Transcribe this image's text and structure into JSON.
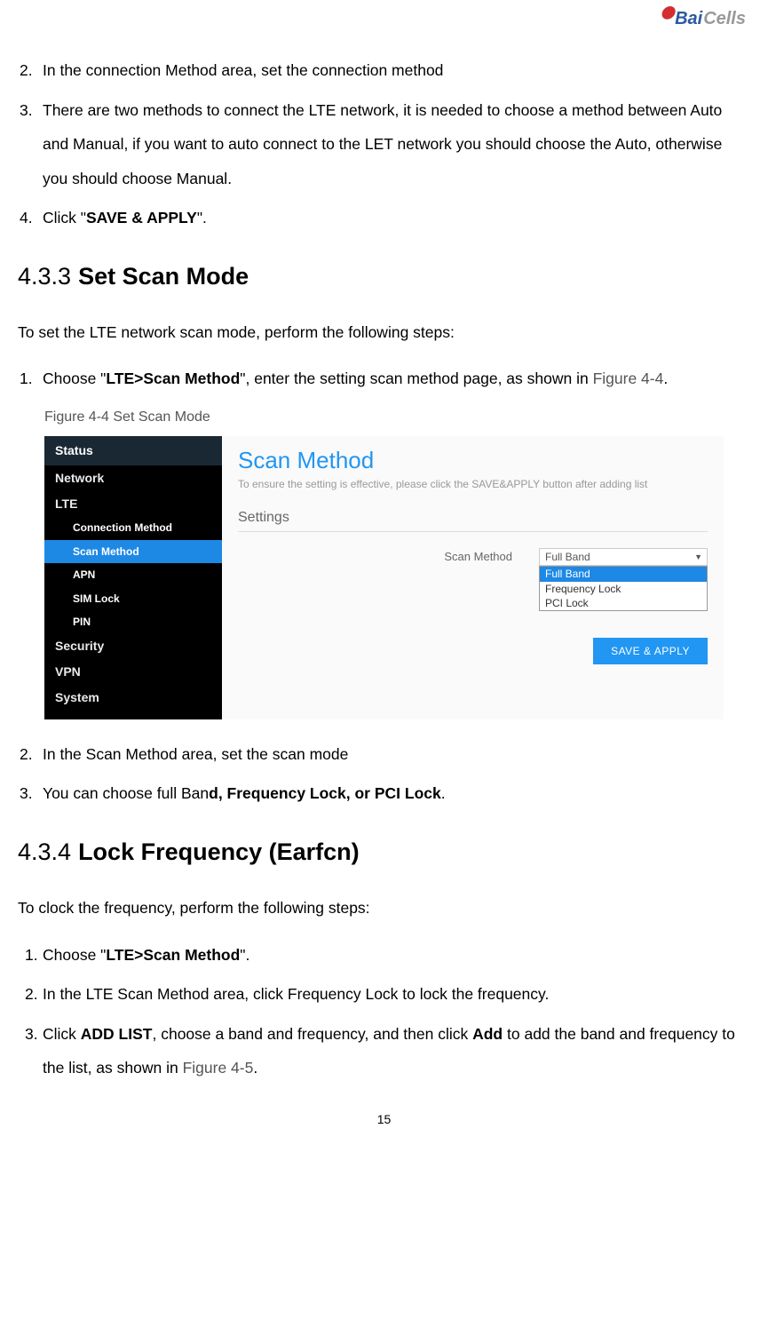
{
  "logo": {
    "part1": "Bai",
    "part2": "Cells"
  },
  "intro_list": [
    {
      "num": "2.",
      "text_pre": "In the connection Method area, set the connection method"
    },
    {
      "num": "3.",
      "text_pre": "There are two methods to connect the LTE network, it is needed to choose a method between Auto and Manual, if you want to auto connect to the LET network you should choose the Auto, otherwise you should choose Manual."
    },
    {
      "num": "4.",
      "text_pre": "Click \"",
      "bold": "SAVE & APPLY",
      "text_post": "\"."
    }
  ],
  "h433": {
    "num": "4.3.3",
    "name": "Set Scan Mode"
  },
  "h433_intro": "To set the LTE network scan mode, perform the following steps:",
  "h433_step1": {
    "num": "1.",
    "pre": "Choose \"",
    "bold": "LTE>Scan Method",
    "mid": "\", enter the setting scan method page, as shown in ",
    "ref": "Figure 4-4",
    "post": "."
  },
  "fig44_caption": "Figure 4-4 Set Scan Mode",
  "screenshot": {
    "sidebar": {
      "items": [
        "Status",
        "Network",
        "LTE"
      ],
      "subs": [
        "Connection Method",
        "Scan Method",
        "APN",
        "SIM Lock",
        "PIN"
      ],
      "active_sub": "Scan Method",
      "items_after": [
        "Security",
        "VPN",
        "System"
      ]
    },
    "panel": {
      "title": "Scan Method",
      "sub": "To ensure the setting is effective, please click the SAVE&APPLY button after adding list",
      "section": "Settings",
      "label": "Scan Method",
      "selected": "Full Band",
      "options": [
        "Full Band",
        "Frequency Lock",
        "PCI Lock"
      ],
      "button": "SAVE & APPLY"
    }
  },
  "after_fig": [
    {
      "num": "2.",
      "text": "In the Scan Method area, set the scan mode"
    },
    {
      "num": "3.",
      "pre": "You can choose full Ban",
      "bold": "d, Frequency Lock, or PCI Lock",
      "post": "."
    }
  ],
  "h434": {
    "num": "4.3.4",
    "name": "Lock Frequency (Earfcn)"
  },
  "h434_intro": "To clock the frequency, perform the following steps:",
  "h434_list": [
    {
      "num": "1.",
      "pre": "Choose \"",
      "bold": "LTE>Scan Method",
      "post": "\"."
    },
    {
      "num": "2.",
      "text": "In the LTE Scan Method area, click Frequency Lock to lock the frequency."
    },
    {
      "num": "3.",
      "pre": "Click ",
      "bold1": "ADD LIST",
      "mid": ", choose a band and frequency, and then click ",
      "bold2": "Add",
      "mid2": " to add the band and frequency to the list, as shown in ",
      "ref": "Figure 4-5",
      "post": "."
    }
  ],
  "page_number": "15"
}
